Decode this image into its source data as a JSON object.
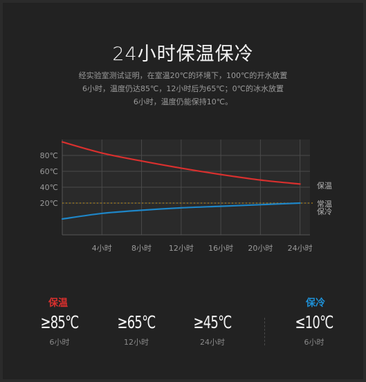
{
  "title": "24小时保温保冷",
  "subtitle_lines": [
    "经实验室测试证明，在室温20℃的环境下，100℃的开水放置",
    "6小时，温度仍达85℃，12小时后为65℃；0℃的冰水放置",
    "6小时，温度仍能保持10℃。"
  ],
  "chart_data": {
    "type": "line",
    "x": [
      0,
      4,
      8,
      12,
      16,
      20,
      24
    ],
    "x_tick_labels": [
      "4小时",
      "8小时",
      "12小时",
      "16小时",
      "20小时",
      "24小时"
    ],
    "y_tick_labels": [
      "80℃",
      "60℃",
      "40℃",
      "20℃"
    ],
    "ylim": [
      -20,
      100
    ],
    "xlim": [
      0,
      25
    ],
    "series": [
      {
        "name": "保温",
        "color": "#d9302e",
        "values": [
          97,
          83,
          73,
          64,
          56,
          49,
          44
        ]
      },
      {
        "name": "常温",
        "color": "#a8801f",
        "style": "dotted",
        "values": [
          20,
          20,
          20,
          20,
          20,
          20,
          20
        ]
      },
      {
        "name": "保冷",
        "color": "#1e86c8",
        "values": [
          0,
          7,
          11,
          14,
          16,
          18,
          20
        ]
      }
    ],
    "grid": true
  },
  "colors": {
    "hot": "#d9302e",
    "cold": "#1e90d6"
  },
  "hot_label": "保温",
  "cold_label": "保冷",
  "stats": [
    {
      "value": "≥85℃",
      "duration": "6小时"
    },
    {
      "value": "≥65℃",
      "duration": "12小时"
    },
    {
      "value": "≥45℃",
      "duration": "24小时"
    },
    {
      "value": "≤10℃",
      "duration": "6小时"
    }
  ]
}
